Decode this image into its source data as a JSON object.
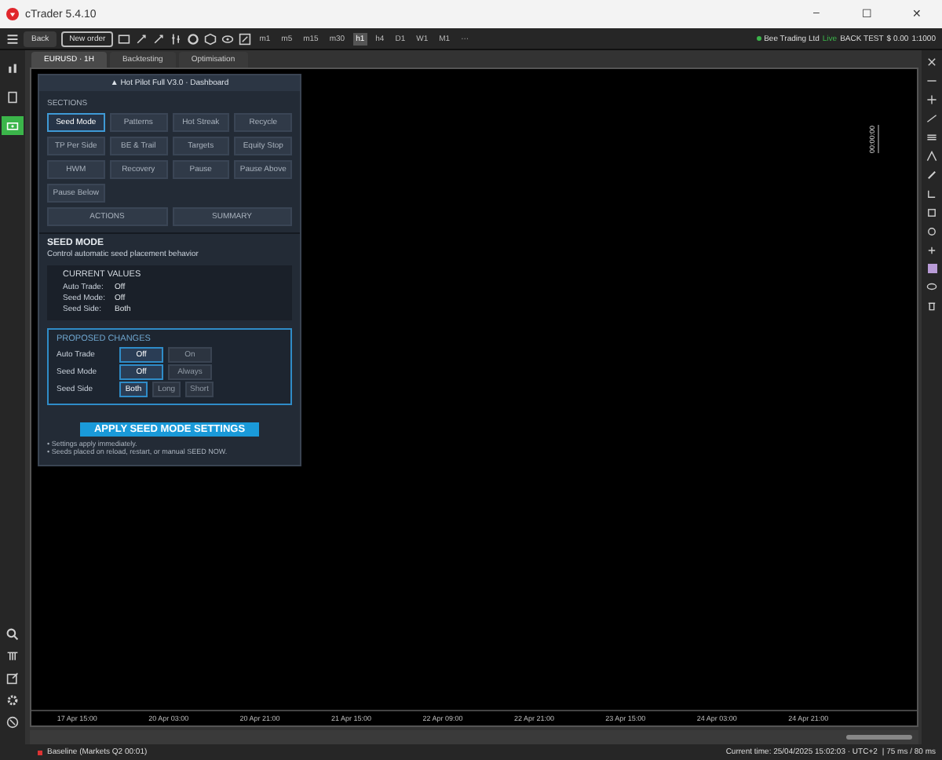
{
  "window": {
    "title": "cTrader 5.4.10",
    "controls": [
      "–",
      "☐",
      "✕"
    ]
  },
  "toolbar": {
    "buttons": [
      {
        "label": "Back",
        "kind": "filled"
      },
      {
        "label": "New order",
        "kind": "outlined"
      }
    ],
    "timeframes": [
      {
        "label": "m1",
        "selected": false
      },
      {
        "label": "m5",
        "selected": false
      },
      {
        "label": "m15",
        "selected": false
      },
      {
        "label": "m30",
        "selected": false
      },
      {
        "label": "h1",
        "selected": true
      },
      {
        "label": "h4",
        "selected": false
      },
      {
        "label": "D1",
        "selected": false
      },
      {
        "label": "W1",
        "selected": false
      },
      {
        "label": "M1",
        "selected": false
      },
      {
        "label": "···",
        "selected": false
      }
    ]
  },
  "account": {
    "broker": "Bee Trading Ltd",
    "mode": "Live",
    "test": "BACK TEST",
    "balance": "$ 0.00",
    "leverage": "1:1000"
  },
  "tabs": [
    {
      "label": "EURUSD · 1H",
      "selected": true
    },
    {
      "label": "Backtesting",
      "selected": false
    },
    {
      "label": "Optimisation",
      "selected": false
    }
  ],
  "chart": {
    "price_label": "00:00:00",
    "axis_labels": [
      "17 Apr 15:00",
      "20 Apr 03:00",
      "20 Apr 21:00",
      "21 Apr 15:00",
      "22 Apr 09:00",
      "22 Apr 21:00",
      "23 Apr 15:00",
      "24 Apr 03:00",
      "24 Apr 21:00"
    ]
  },
  "dashboard": {
    "title": "▲ Hot Pilot Full V3.0 · Dashboard",
    "sections_label": "SECTIONS",
    "sections": [
      {
        "label": "Seed Mode",
        "selected": true
      },
      {
        "label": "Patterns",
        "selected": false
      },
      {
        "label": "Hot Streak",
        "selected": false
      },
      {
        "label": "Recycle",
        "selected": false
      },
      {
        "label": "TP Per Side",
        "selected": false
      },
      {
        "label": "BE & Trail",
        "selected": false
      },
      {
        "label": "Targets",
        "selected": false
      },
      {
        "label": "Equity Stop",
        "selected": false
      },
      {
        "label": "HWM",
        "selected": false
      },
      {
        "label": "Recovery",
        "selected": false
      },
      {
        "label": "Pause",
        "selected": false
      },
      {
        "label": "Pause Above",
        "selected": false
      },
      {
        "label": "Pause Below",
        "selected": false
      }
    ],
    "actions": [
      "ACTIONS",
      "SUMMARY"
    ],
    "heading": "SEED MODE",
    "description": "Control automatic seed placement behavior",
    "current": {
      "title": "CURRENT VALUES",
      "rows": [
        {
          "label": "Auto Trade:",
          "value": "Off"
        },
        {
          "label": "Seed Mode:",
          "value": "Off"
        },
        {
          "label": "Seed Side:",
          "value": "Both"
        }
      ]
    },
    "proposed": {
      "title": "PROPOSED CHANGES",
      "rows": [
        {
          "label": "Auto Trade",
          "options": [
            {
              "label": "Off",
              "selected": true
            },
            {
              "label": "On",
              "selected": false
            }
          ]
        },
        {
          "label": "Seed Mode",
          "options": [
            {
              "label": "Off",
              "selected": true
            },
            {
              "label": "Always",
              "selected": false
            }
          ]
        },
        {
          "label": "Seed Side",
          "options": [
            {
              "label": "Both",
              "selected": true
            },
            {
              "label": "Long",
              "selected": false
            },
            {
              "label": "Short",
              "selected": false
            }
          ]
        }
      ]
    },
    "apply": "APPLY SEED MODE SETTINGS",
    "notes": [
      "• Settings apply immediately.",
      "• Seeds placed on reload, restart, or manual SEED NOW."
    ]
  },
  "status_bar": {
    "left": "Baseline (Markets Q2 00:01)",
    "time": "Current time: 25/04/2025 15:02:03 · UTC+2",
    "latency": "| 75 ms / 80 ms"
  }
}
